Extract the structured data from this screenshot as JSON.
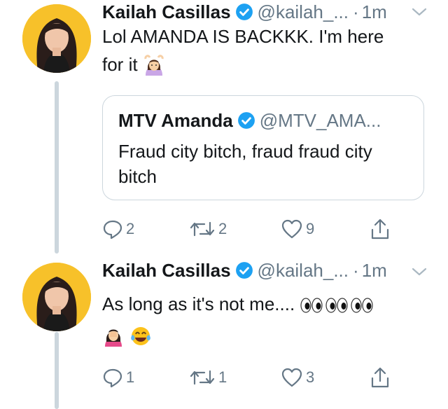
{
  "tweets": [
    {
      "author_name": "Kailah Casillas",
      "handle": "@kailah_...",
      "separator": "·",
      "time": "1m",
      "text_line1": "Lol AMANDA IS BACKKK. I'm here",
      "text_line2": "for it",
      "text_emoji": "woman-gesturing-ok",
      "quote": {
        "author_name": "MTV Amanda",
        "handle": "@MTV_AMA...",
        "text": "Fraud city bitch, fraud fraud city bitch"
      },
      "actions": {
        "replies": "2",
        "retweets": "2",
        "likes": "9"
      }
    },
    {
      "author_name": "Kailah Casillas",
      "handle": "@kailah_...",
      "separator": "·",
      "time": "1m",
      "text_line1": "As long as it's not me....",
      "text_emojis": [
        "eyes",
        "eyes",
        "eyes",
        "woman-facepalming",
        "face-with-tears-of-joy"
      ],
      "actions": {
        "replies": "1",
        "retweets": "1",
        "likes": "3"
      }
    }
  ],
  "colors": {
    "verified": "#1da1f2",
    "muted": "#657786",
    "line": "#ccd6dd",
    "avatar_bg": "#f7c12a"
  }
}
